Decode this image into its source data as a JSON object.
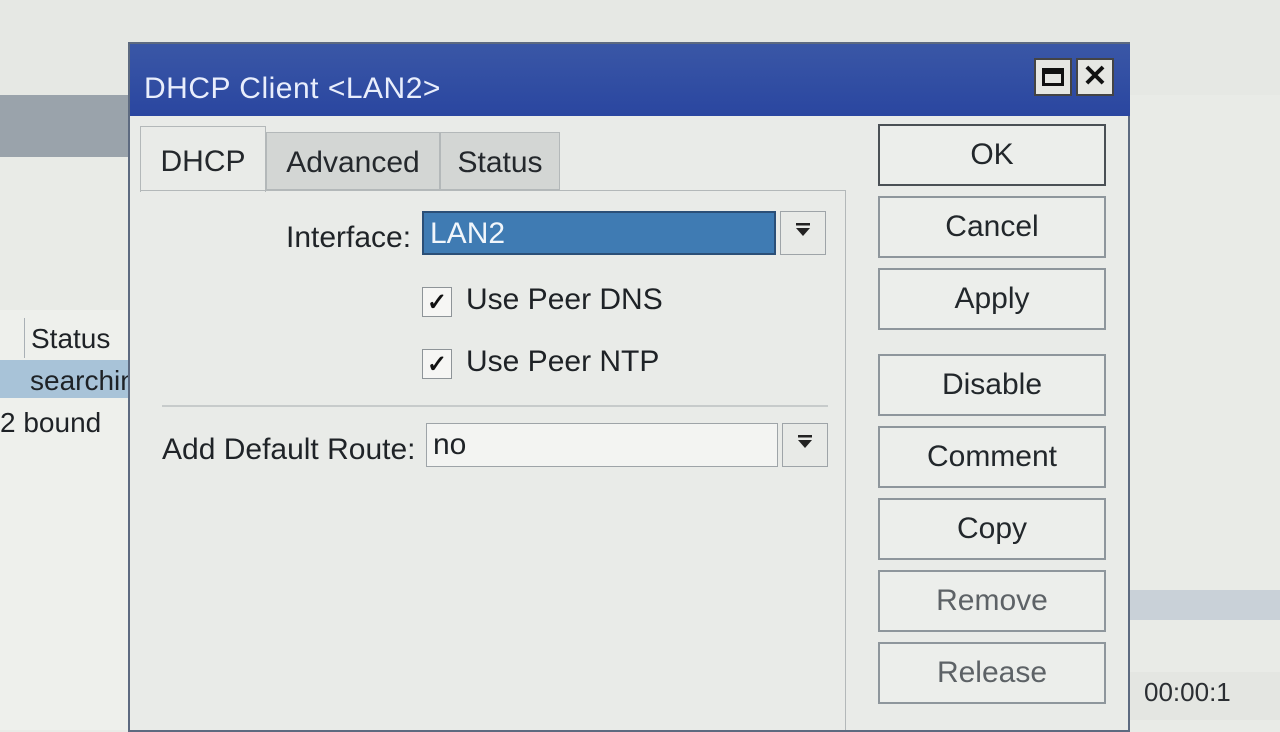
{
  "background": {
    "column_header": "Status",
    "rows": [
      "searchin",
      "2 bound"
    ],
    "right_fragment": "00:00:1"
  },
  "dialog": {
    "title": "DHCP Client <LAN2>",
    "tabs": [
      "DHCP",
      "Advanced",
      "Status"
    ],
    "active_tab": "DHCP",
    "interface_label": "Interface:",
    "interface_value": "LAN2",
    "use_peer_dns_label": "Use Peer DNS",
    "use_peer_dns_checked": true,
    "use_peer_ntp_label": "Use Peer NTP",
    "use_peer_ntp_checked": true,
    "add_default_route_label": "Add Default Route:",
    "add_default_route_value": "no",
    "buttons": {
      "ok": "OK",
      "cancel": "Cancel",
      "apply": "Apply",
      "disable": "Disable",
      "comment": "Comment",
      "copy": "Copy",
      "remove": "Remove",
      "release": "Release"
    }
  },
  "icons": {
    "maximize": "maximize-icon",
    "close": "close-icon",
    "dropdown": "dropdown-arrow-icon",
    "check": "check-icon"
  },
  "colors": {
    "titlebar": "#2a46a0",
    "selection": "#3f7bb3"
  }
}
